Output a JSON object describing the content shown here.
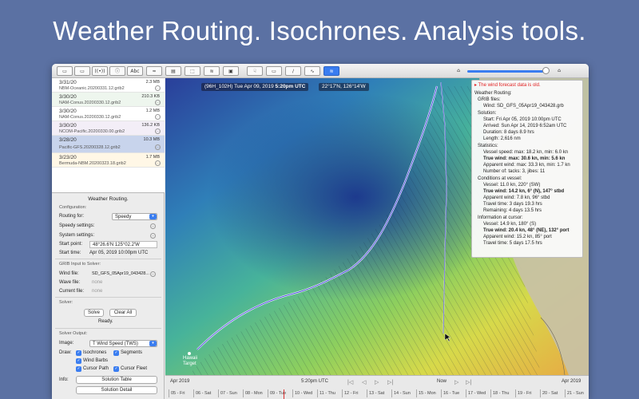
{
  "headline": "Weather Routing.  Isochrones.  Analysis tools.",
  "toolbar": {
    "buttons": [
      "▭",
      "▭",
      "((•))",
      "ⓘ",
      "Abc",
      "≈",
      "▤",
      "⬚",
      "≋",
      "▣",
      "☟",
      "▭",
      "∕",
      "∿",
      "≋"
    ]
  },
  "files": [
    {
      "date": "3/31/20",
      "size": "2.3 MB",
      "name": "NBM-Oceanic.20200331.12.grib2"
    },
    {
      "date": "3/30/20",
      "size": "210.3 KB",
      "name": "NAM-Conus.20200330.12.grib2"
    },
    {
      "date": "3/30/20",
      "size": "1.2 MB",
      "name": "NAM-Conus.20200330.12.grib2"
    },
    {
      "date": "3/30/20",
      "size": "136.2 KB",
      "name": "NCOM-Pacific.20200330.00.grib2"
    },
    {
      "date": "3/28/20",
      "size": "10.3 MB",
      "name": "Pacific-GFS.20200328.12.grib2"
    },
    {
      "date": "3/23/20",
      "size": "1.7 MB",
      "name": "Bermuda-NBM.20200323.18.grib2"
    }
  ],
  "panel": {
    "title": "Weather Routing.",
    "configuration": "Configuration:",
    "routing_for_label": "Routing for:",
    "routing_for_value": "Speedy",
    "speedy_settings": "Speedy settings:",
    "system_settings": "System settings:",
    "start_point_label": "Start point:",
    "start_point_value": "48°26.6'N 125°02.2'W",
    "start_time_label": "Start time:",
    "start_time_value": "Apr 05, 2019 10:00pm UTC",
    "grib_input": "GRIB Input to Solver:",
    "wind_file_label": "Wind file:",
    "wind_file_value": "SD_GFS_05Apr19_043428...",
    "wave_file_label": "Wave file:",
    "wave_file_value": "none",
    "current_file_label": "Current file:",
    "current_file_value": "none",
    "solver": "Solver:",
    "solve": "Solve",
    "clear_all": "Clear All",
    "ready": "Ready.",
    "solver_output": "Solver Output:",
    "image_label": "Image:",
    "image_value": "T Wind Speed (TWS)",
    "draw_label": "Draw:",
    "isochrones": "Isochrones",
    "segments": "Segments",
    "wind_barbs": "Wind Barbs",
    "cursor_path": "Cursor Path",
    "cursor_fleet": "Cursor Fleet",
    "info_label": "Info:",
    "solution_table": "Solution Table",
    "solution_detail": "Solution Detail"
  },
  "map": {
    "forecast_label": "(96H_102H) Tue Apr 09, 2019",
    "forecast_time": "5:20pm UTC",
    "coords": "22°17'N, 126°14'W",
    "target": "Hawaii Target"
  },
  "info": {
    "warning": "The wind forecast data is old.",
    "weather_routing": "Weather Routing:",
    "grib_files": "GRIB files:",
    "wind": "Wind: SD_GFS_05Apr19_043428.grb",
    "solution": "Solution:",
    "start": "Start: Fri Apr 05, 2019 10:00pm UTC",
    "arrived": "Arrived: Sun Apr 14, 2019 6:52am UTC",
    "duration": "Duration: 8 days 8.9 hrs",
    "length": "Length: 2,616 nm",
    "statistics": "Statistics:",
    "vessel_speed": "Vessel speed: max: 18.2 kn, min: 6.0 kn",
    "true_wind_max": "True wind: max: 30.6 kn, min: 5.6 kn",
    "apparent_wind": "Apparent wind: max: 33.3 kn, min: 1.7 kn",
    "tacks": "Number of: tacks: 3, jibes: 11",
    "conditions": "Conditions at vessel:",
    "vessel": "Vessel: 11.0 kn, 220° (SW)",
    "true_wind_vessel": "True wind: 14.2 kn, 6° (N), 147° stbd",
    "apparent_vessel": "Apparent wind: 7.8 kn, 96° stbd",
    "travel_time": "Travel time: 3 days 19.3 hrs",
    "remaining": "Remaining: 4 days 13.5 hrs",
    "info_cursor": "Information at cursor:",
    "vessel_cursor": "Vessel: 14.9 kn, 180° (S)",
    "true_wind_cursor": "True wind: 20.4 kn, 48° (NE), 132° port",
    "apparent_cursor": "Apparent wind: 15.2 kn, 85° port",
    "travel_cursor": "Travel time: 5 days 17.5 hrs"
  },
  "timeline": {
    "left_month": "Apr 2019",
    "center_time": "5:20pm UTC",
    "now": "Now",
    "right_month": "Apr 2019",
    "days": [
      "05 - Fri",
      "06 - Sat",
      "07 - Sun",
      "08 - Mon",
      "09 - Tue",
      "10 - Wed",
      "11 - Thu",
      "12 - Fri",
      "13 - Sat",
      "14 - Sun",
      "15 - Mon",
      "16 - Tue",
      "17 - Wed",
      "18 - Thu",
      "19 - Fri",
      "20 - Sat",
      "21 - Sun"
    ]
  }
}
